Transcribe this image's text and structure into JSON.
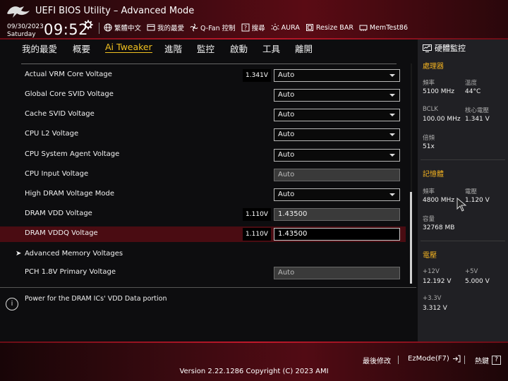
{
  "header": {
    "title": "UEFI BIOS Utility – Advanced Mode",
    "date": "09/30/2023",
    "day": "Saturday",
    "time": "09:52",
    "tools": [
      {
        "icon": "globe-icon",
        "label": "繁體中文"
      },
      {
        "icon": "favorites-icon",
        "label": "我的最愛"
      },
      {
        "icon": "fan-icon",
        "label": "Q-Fan 控制"
      },
      {
        "icon": "search-help-icon",
        "label": "搜尋"
      },
      {
        "icon": "aura-icon",
        "label": "AURA"
      },
      {
        "icon": "resize-bar-icon",
        "label": "Resize BAR"
      },
      {
        "icon": "memtest-icon",
        "label": "MemTest86"
      }
    ]
  },
  "nav": {
    "tabs": [
      {
        "label": "我的最愛",
        "active": false
      },
      {
        "label": "概要",
        "active": false
      },
      {
        "label": "Ai Tweaker",
        "active": true
      },
      {
        "label": "進階",
        "active": false
      },
      {
        "label": "監控",
        "active": false
      },
      {
        "label": "啟動",
        "active": false
      },
      {
        "label": "工具",
        "active": false
      },
      {
        "label": "離開",
        "active": false
      }
    ]
  },
  "settings": [
    {
      "label": "Actual VRM Core Voltage",
      "value": "1.341V",
      "control": "Auto",
      "type": "dropdown"
    },
    {
      "label": "Global Core SVID Voltage",
      "value": "",
      "control": "Auto",
      "type": "dropdown"
    },
    {
      "label": "Cache SVID Voltage",
      "value": "",
      "control": "Auto",
      "type": "dropdown"
    },
    {
      "label": "CPU L2 Voltage",
      "value": "",
      "control": "Auto",
      "type": "dropdown"
    },
    {
      "label": "CPU System Agent Voltage",
      "value": "",
      "control": "Auto",
      "type": "dropdown"
    },
    {
      "label": "CPU Input Voltage",
      "value": "",
      "control": "Auto",
      "type": "disabled"
    },
    {
      "label": "High DRAM Voltage Mode",
      "value": "",
      "control": "Auto",
      "type": "dropdown"
    },
    {
      "label": "DRAM VDD Voltage",
      "value": "1.110V",
      "control": "1.43500",
      "type": "text"
    },
    {
      "label": "DRAM VDDQ Voltage",
      "value": "1.110V",
      "control": "1.43500",
      "type": "text",
      "selected": true
    },
    {
      "label": "Advanced Memory Voltages",
      "value": "",
      "control": "",
      "type": "submenu"
    },
    {
      "label": "PCH 1.8V Primary Voltage",
      "value": "",
      "control": "Auto",
      "type": "disabled"
    }
  ],
  "help": {
    "text": "Power for the DRAM ICs' VDD Data portion"
  },
  "monitor": {
    "title": "硬體監控",
    "cpu": {
      "section": "處理器",
      "freq_label": "頻率",
      "freq": "5100 MHz",
      "temp_label": "溫度",
      "temp": "44°C",
      "bclk_label": "BCLK",
      "bclk": "100.00 MHz",
      "vcore_label": "核心電壓",
      "vcore": "1.341 V",
      "ratio_label": "倍頻",
      "ratio": "51x"
    },
    "memory": {
      "section": "記憶體",
      "freq_label": "頻率",
      "freq": "4800 MHz",
      "volt_label": "電壓",
      "volt": "1.120 V",
      "cap_label": "容量",
      "cap": "32768 MB"
    },
    "voltage": {
      "section": "電壓",
      "v12_label": "+12V",
      "v12": "12.192 V",
      "v5_label": "+5V",
      "v5": "5.000 V",
      "v33_label": "+3.3V",
      "v33": "3.312 V"
    }
  },
  "footer": {
    "last_modified": "最後修改",
    "ezmode": "EzMode(F7)",
    "hotkeys": "熱鍵",
    "hotkeys_key": "?",
    "copyright": "Version 2.22.1286 Copyright (C) 2023 AMI"
  },
  "colors": {
    "accent": "#f0c020",
    "section": "#f0b020",
    "selected_row": "#4a0c12",
    "brand_red": "#c0182a"
  }
}
